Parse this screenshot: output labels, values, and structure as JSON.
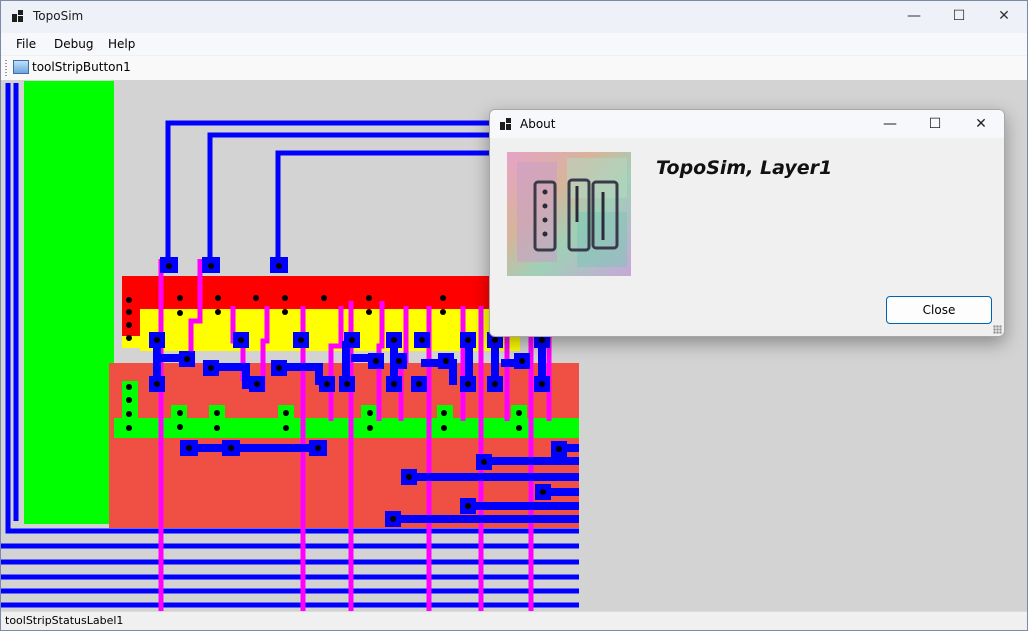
{
  "window": {
    "title": "TopoSim",
    "controls": [
      "minimize",
      "maximize",
      "close"
    ]
  },
  "menu": {
    "items": [
      "File",
      "Debug",
      "Help"
    ]
  },
  "toolbar": {
    "button_label": "toolStripButton1",
    "button_icon": "image-icon"
  },
  "status": {
    "label": "toolStripStatusLabel1"
  },
  "about_dialog": {
    "title": "About",
    "heading": "TopoSim, Layer1",
    "close_label": "Close",
    "image": "chip-photo"
  },
  "colors": {
    "metal": "#0000ff",
    "poly": "#ff00ff",
    "diffusion_n": "#ff0000",
    "diffusion_p": "#ffff00",
    "power_rail": "#00ff00",
    "well": "#f05044",
    "background": "#d3d3d3",
    "accent": "#0063b1"
  }
}
